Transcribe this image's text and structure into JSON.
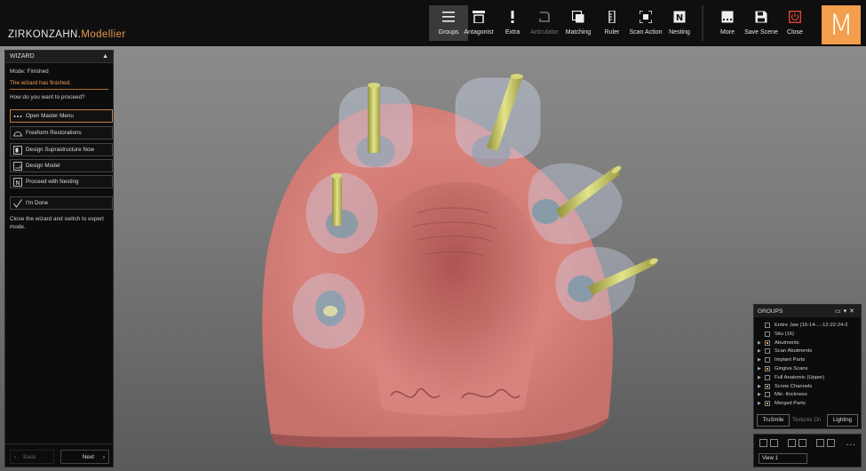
{
  "app": {
    "brand_main": "ZIRKONZAHN.",
    "brand_accent": "Modellier",
    "logo_letter": "M"
  },
  "toolbar": [
    {
      "id": "groups",
      "label": "Groups",
      "icon": "menu-icon",
      "active": true
    },
    {
      "id": "antagonist",
      "label": "Antagonist",
      "icon": "antagonist-icon"
    },
    {
      "id": "extra",
      "label": "Extra",
      "icon": "exclamation-icon"
    },
    {
      "id": "articulator",
      "label": "Articulator",
      "icon": "articulator-icon",
      "disabled": true
    },
    {
      "id": "matching",
      "label": "Matching",
      "icon": "matching-icon"
    },
    {
      "id": "ruler",
      "label": "Ruler",
      "icon": "ruler-icon"
    },
    {
      "id": "scan_action",
      "label": "Scan Action",
      "icon": "scan-action-icon"
    },
    {
      "id": "nesting",
      "label": "Nesting",
      "icon": "nesting-icon"
    }
  ],
  "toolbar_right": [
    {
      "id": "more",
      "label": "More",
      "icon": "more-icon"
    },
    {
      "id": "save_scene",
      "label": "Save Scene",
      "icon": "save-icon"
    },
    {
      "id": "close",
      "label": "Close",
      "icon": "close-power-icon"
    }
  ],
  "wizard": {
    "title": "WIZARD",
    "mode": "Mode: Finished",
    "status": "The wizard has finished.",
    "question": "How do you want to proceed?",
    "options": [
      {
        "label": "Open Master Menu",
        "icon": "dots-icon",
        "selected": true
      },
      {
        "label": "Freeform Restorations",
        "icon": "freeform-icon"
      },
      {
        "label": "Design Suprastructure Now",
        "icon": "suprastructure-icon"
      },
      {
        "label": "Design Model",
        "icon": "model-icon"
      },
      {
        "label": "Proceed with Nesting",
        "icon": "nesting-letter-icon"
      }
    ],
    "done": {
      "label": "I'm Done",
      "icon": "checkmark-icon"
    },
    "done_hint": "Close the wizard and switch to expert mode.",
    "back_label": "Back",
    "next_label": "Next"
  },
  "groups": {
    "title": "GROUPS",
    "items": [
      {
        "label": "Entire Jaw (16-14-...-12-22-24-2",
        "arrow": false,
        "checked": false
      },
      {
        "label": "Situ (16)",
        "arrow": false,
        "checked": false
      },
      {
        "label": "Abutments",
        "arrow": true,
        "checked": true
      },
      {
        "label": "Scan Abutments",
        "arrow": true,
        "checked": false
      },
      {
        "label": "Implant Parts",
        "arrow": true,
        "checked": false
      },
      {
        "label": "Gingiva Scans",
        "arrow": true,
        "checked": true
      },
      {
        "label": "Full Anatomic (Upper)",
        "arrow": true,
        "checked": false
      },
      {
        "label": "Screw Channels",
        "arrow": true,
        "checked": true
      },
      {
        "label": "Min. thickness",
        "arrow": true,
        "checked": false
      },
      {
        "label": "Merged Parts",
        "arrow": true,
        "checked": true
      }
    ],
    "trusmile": "TruSmile",
    "textures": "Textures On",
    "lighting": "Lighting"
  },
  "views": {
    "current": "View 1",
    "more": "..."
  },
  "colors": {
    "accent": "#f29e4c",
    "gingiva": "#d77a74",
    "screw_channel": "#c8c86a"
  }
}
